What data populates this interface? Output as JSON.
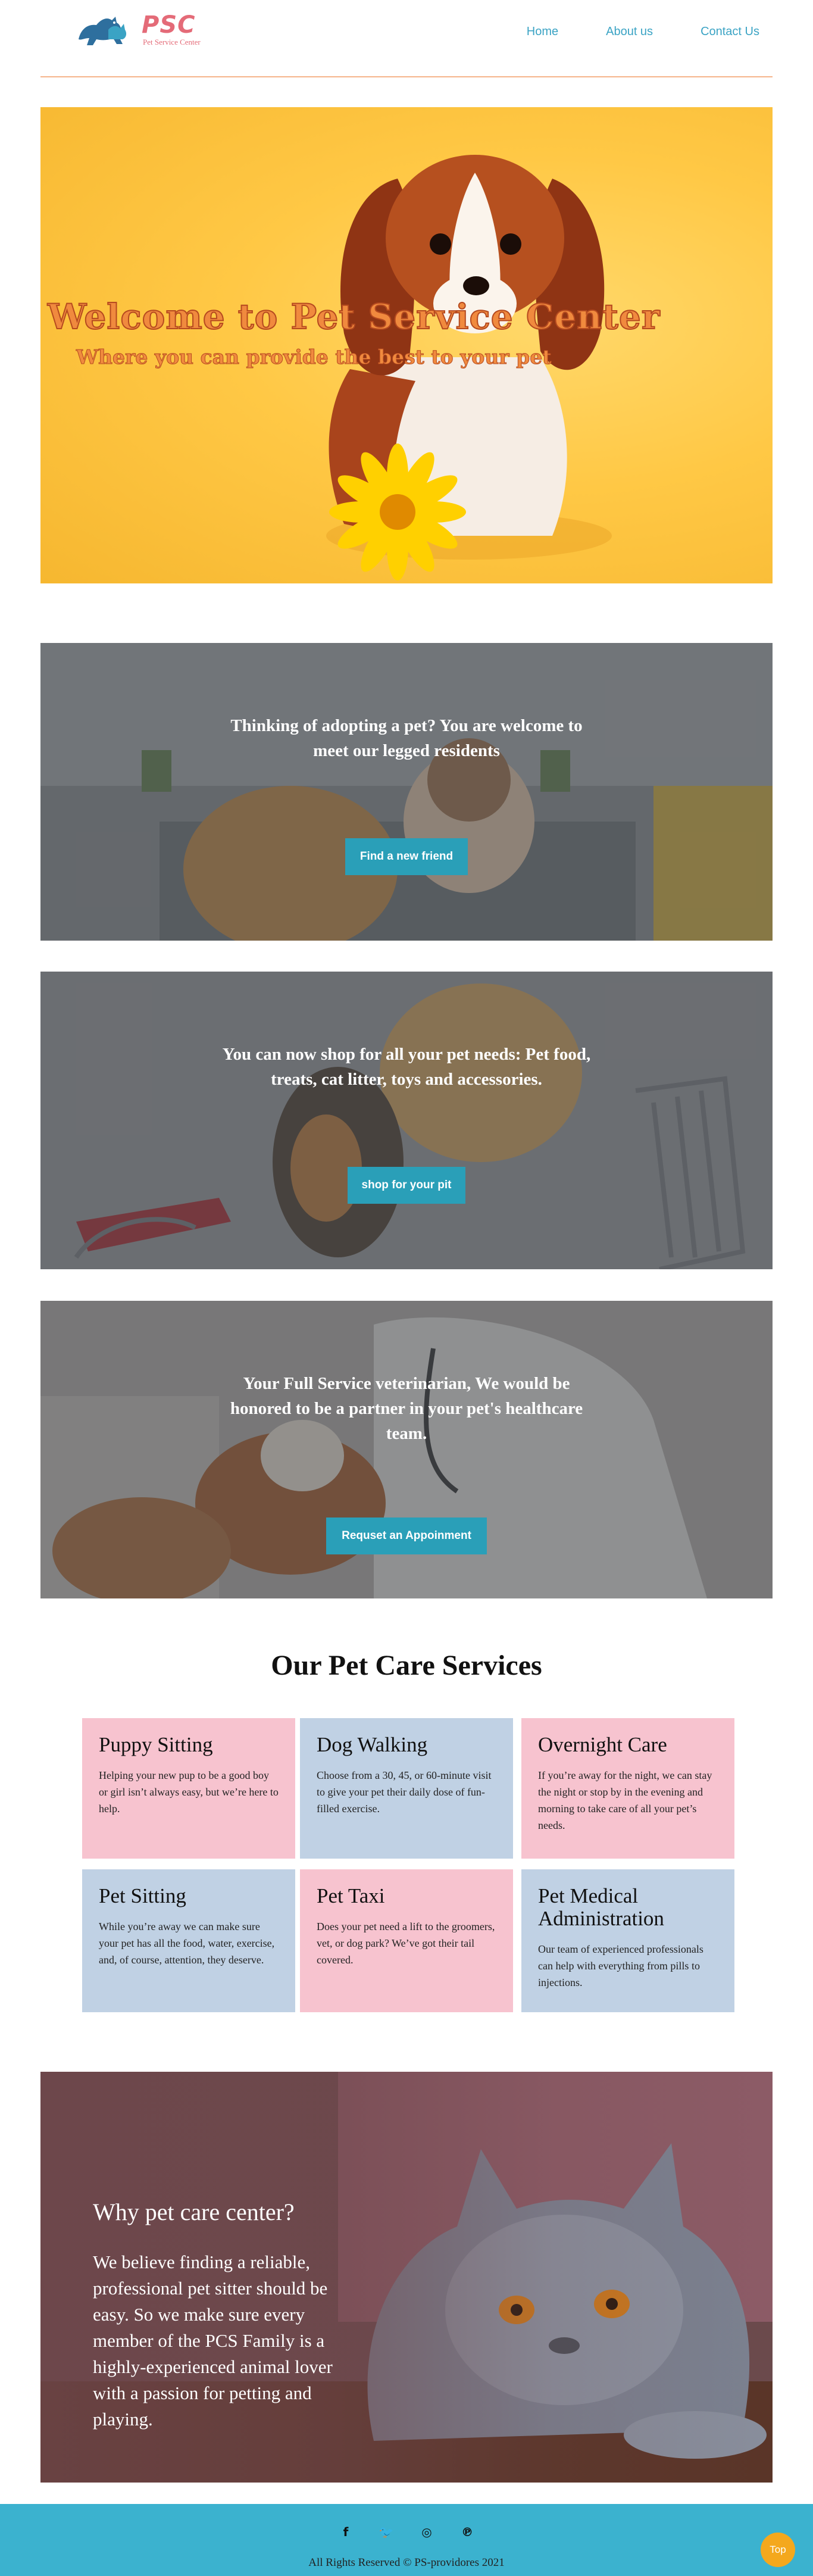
{
  "brand": {
    "logo_text": "PSC",
    "logo_subtitle": "Pet Service Center"
  },
  "nav": {
    "items": [
      "Home",
      "About us",
      "Contact Us"
    ]
  },
  "hero": {
    "title": "Welcome to Pet Service Center",
    "subtitle": "Where you can provide the best to your pet"
  },
  "panels": [
    {
      "text": "Thinking of adopting a pet? You are welcome to meet our legged residents",
      "button": "Find a new friend"
    },
    {
      "text": "You can now shop for all your pet needs: Pet food, treats, cat litter, toys and accessories.",
      "button": "shop for your pit"
    },
    {
      "text": "Your Full Service veterinarian, We would be honored to be a partner in your pet's healthcare team.",
      "button": "Requset an Appoinment"
    }
  ],
  "services": {
    "title": "Our Pet Care Services",
    "cards": [
      {
        "title": "Puppy Sitting",
        "text": "Helping your new pup to be a good boy or girl isn’t always easy, but we’re here to help.",
        "color": "#f7c3cf"
      },
      {
        "title": "Dog Walking",
        "text": "Choose from a 30, 45, or 60-minute visit to give your pet their daily dose of fun-filled exercise.",
        "color": "#c0d1e4"
      },
      {
        "title": "Overnight Care",
        "text": "If you’re away for the night, we can stay the night or stop by in the evening and morning to take care of all your pet’s needs.",
        "color": "#f7c3cf"
      },
      {
        "title": "Pet Sitting",
        "text": "While you’re away we can make sure your pet has all the food, water, exercise, and, of course, attention, they deserve.",
        "color": "#c0d1e4"
      },
      {
        "title": "Pet Taxi",
        "text": "Does your pet need a lift to the groomers, vet, or dog park? We’ve got their tail covered.",
        "color": "#f7c3cf"
      },
      {
        "title": "Pet Medical Administration",
        "text": "Our team of experienced professionals can help with everything from pills to injections.",
        "color": "#c0d1e4"
      }
    ]
  },
  "why": {
    "title": "Why pet care center?",
    "text": "We believe finding a reliable, professional pet sitter should be easy. So we make sure every member of the PCS Family is a highly-experienced animal lover with a passion for petting and playing."
  },
  "footer": {
    "social": {
      "facebook": "f",
      "twitter": "🐦",
      "instagram": "◎",
      "pinterest": "℗"
    },
    "copyright": "All Rights Reserved © PS-providores 2021",
    "top_button": "Top"
  },
  "colors": {
    "accent": "#2a9fb8",
    "footer": "#3bb2cf",
    "nav": "#3aa3c4",
    "logo": "#e46b78",
    "top": "#f4a81d"
  }
}
